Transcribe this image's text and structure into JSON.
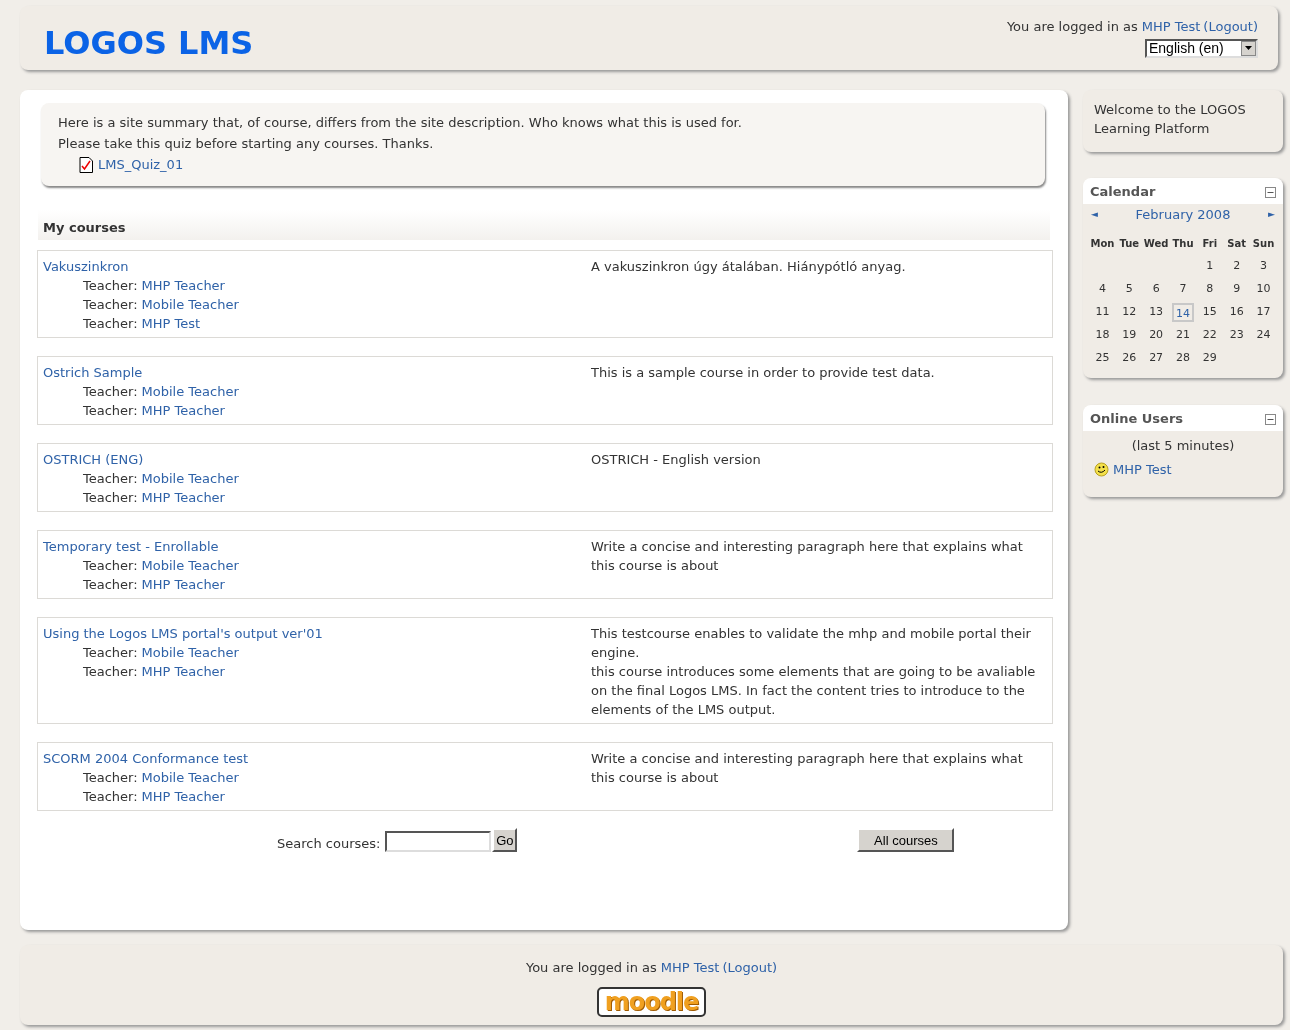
{
  "header": {
    "site_name": "LOGOS LMS",
    "login_text": "You are logged in as",
    "user": "MHP Test",
    "logout": "(Logout)",
    "language": "English (en)"
  },
  "summary": {
    "lines": [
      "Here is a site summary that, of course, differs from the site description. Who knows what this is used for.",
      "Please take this quiz before starting any courses. Thanks."
    ],
    "quiz_link": "LMS_Quiz_01"
  },
  "my_courses": {
    "title": "My courses",
    "courses": [
      {
        "name": "Vakuszinkron",
        "teachers": [
          {
            "role": "Teacher:",
            "name": "MHP Teacher"
          },
          {
            "role": "Teacher:",
            "name": "Mobile Teacher"
          },
          {
            "role": "Teacher:",
            "name": "MHP Test"
          }
        ],
        "summary": [
          "A vakuszinkron úgy átalában. Hiánypótló anyag."
        ]
      },
      {
        "name": "Ostrich Sample",
        "teachers": [
          {
            "role": "Teacher:",
            "name": "Mobile Teacher"
          },
          {
            "role": "Teacher:",
            "name": "MHP Teacher"
          }
        ],
        "summary": [
          "This is a sample course in order to provide test data."
        ]
      },
      {
        "name": "OSTRICH (ENG)",
        "teachers": [
          {
            "role": "Teacher:",
            "name": "Mobile Teacher"
          },
          {
            "role": "Teacher:",
            "name": "MHP Teacher"
          }
        ],
        "summary": [
          "OSTRICH - English version"
        ]
      },
      {
        "name": "Temporary test - Enrollable",
        "teachers": [
          {
            "role": "Teacher:",
            "name": "Mobile Teacher"
          },
          {
            "role": "Teacher:",
            "name": "MHP Teacher"
          }
        ],
        "summary": [
          "Write a concise and interesting paragraph here that explains what this course is about"
        ]
      },
      {
        "name": "Using the Logos LMS portal's output ver'01",
        "teachers": [
          {
            "role": "Teacher:",
            "name": "Mobile Teacher"
          },
          {
            "role": "Teacher:",
            "name": "MHP Teacher"
          }
        ],
        "summary": [
          "This testcourse enables to validate the mhp and mobile portal their engine.",
          "this course introduces some elements that are going to be avaliable on the final Logos LMS. In fact the content tries to introduce to the elements of the LMS output."
        ]
      },
      {
        "name": "SCORM 2004 Conformance test",
        "teachers": [
          {
            "role": "Teacher:",
            "name": "Mobile Teacher"
          },
          {
            "role": "Teacher:",
            "name": "MHP Teacher"
          }
        ],
        "summary": [
          "Write a concise and interesting paragraph here that explains what this course is about"
        ]
      }
    ]
  },
  "search": {
    "label": "Search courses:",
    "go": "Go",
    "all_courses": "All courses"
  },
  "welcome": {
    "text": "Welcome to the LOGOS Learning Platform"
  },
  "calendar": {
    "title": "Calendar",
    "month": "February 2008",
    "prev": "◄",
    "next": "►",
    "weekdays": [
      "Mon",
      "Tue",
      "Wed",
      "Thu",
      "Fri",
      "Sat",
      "Sun"
    ],
    "weeks": [
      {
        "kind": "first",
        "days": [
          {
            "day": "1",
            "today": false
          },
          {
            "day": "2",
            "today": false
          },
          {
            "day": "3",
            "today": false
          }
        ]
      },
      {
        "kind": "week",
        "days": [
          {
            "day": "4",
            "today": false
          },
          {
            "day": "5",
            "today": false
          },
          {
            "day": "6",
            "today": false
          },
          {
            "day": "7",
            "today": false
          },
          {
            "day": "8",
            "today": false
          },
          {
            "day": "9",
            "today": false
          },
          {
            "day": "10",
            "today": false
          }
        ]
      },
      {
        "kind": "week",
        "days": [
          {
            "day": "11",
            "today": false
          },
          {
            "day": "12",
            "today": false
          },
          {
            "day": "13",
            "today": false
          },
          {
            "day": "14",
            "today": true
          },
          {
            "day": "15",
            "today": false
          },
          {
            "day": "16",
            "today": false
          },
          {
            "day": "17",
            "today": false
          }
        ]
      },
      {
        "kind": "week",
        "days": [
          {
            "day": "18",
            "today": false
          },
          {
            "day": "19",
            "today": false
          },
          {
            "day": "20",
            "today": false
          },
          {
            "day": "21",
            "today": false
          },
          {
            "day": "22",
            "today": false
          },
          {
            "day": "23",
            "today": false
          },
          {
            "day": "24",
            "today": false
          }
        ]
      },
      {
        "kind": "week",
        "days": [
          {
            "day": "25",
            "today": false
          },
          {
            "day": "26",
            "today": false
          },
          {
            "day": "27",
            "today": false
          },
          {
            "day": "28",
            "today": false
          },
          {
            "day": "29",
            "today": false
          }
        ]
      }
    ]
  },
  "online_users": {
    "title": "Online Users",
    "period": "(last 5 minutes)",
    "users": [
      "MHP Test"
    ]
  },
  "footer": {
    "login_text": "You are logged in as",
    "user": "MHP Test",
    "logout": "(Logout)",
    "logo": "moodle"
  }
}
